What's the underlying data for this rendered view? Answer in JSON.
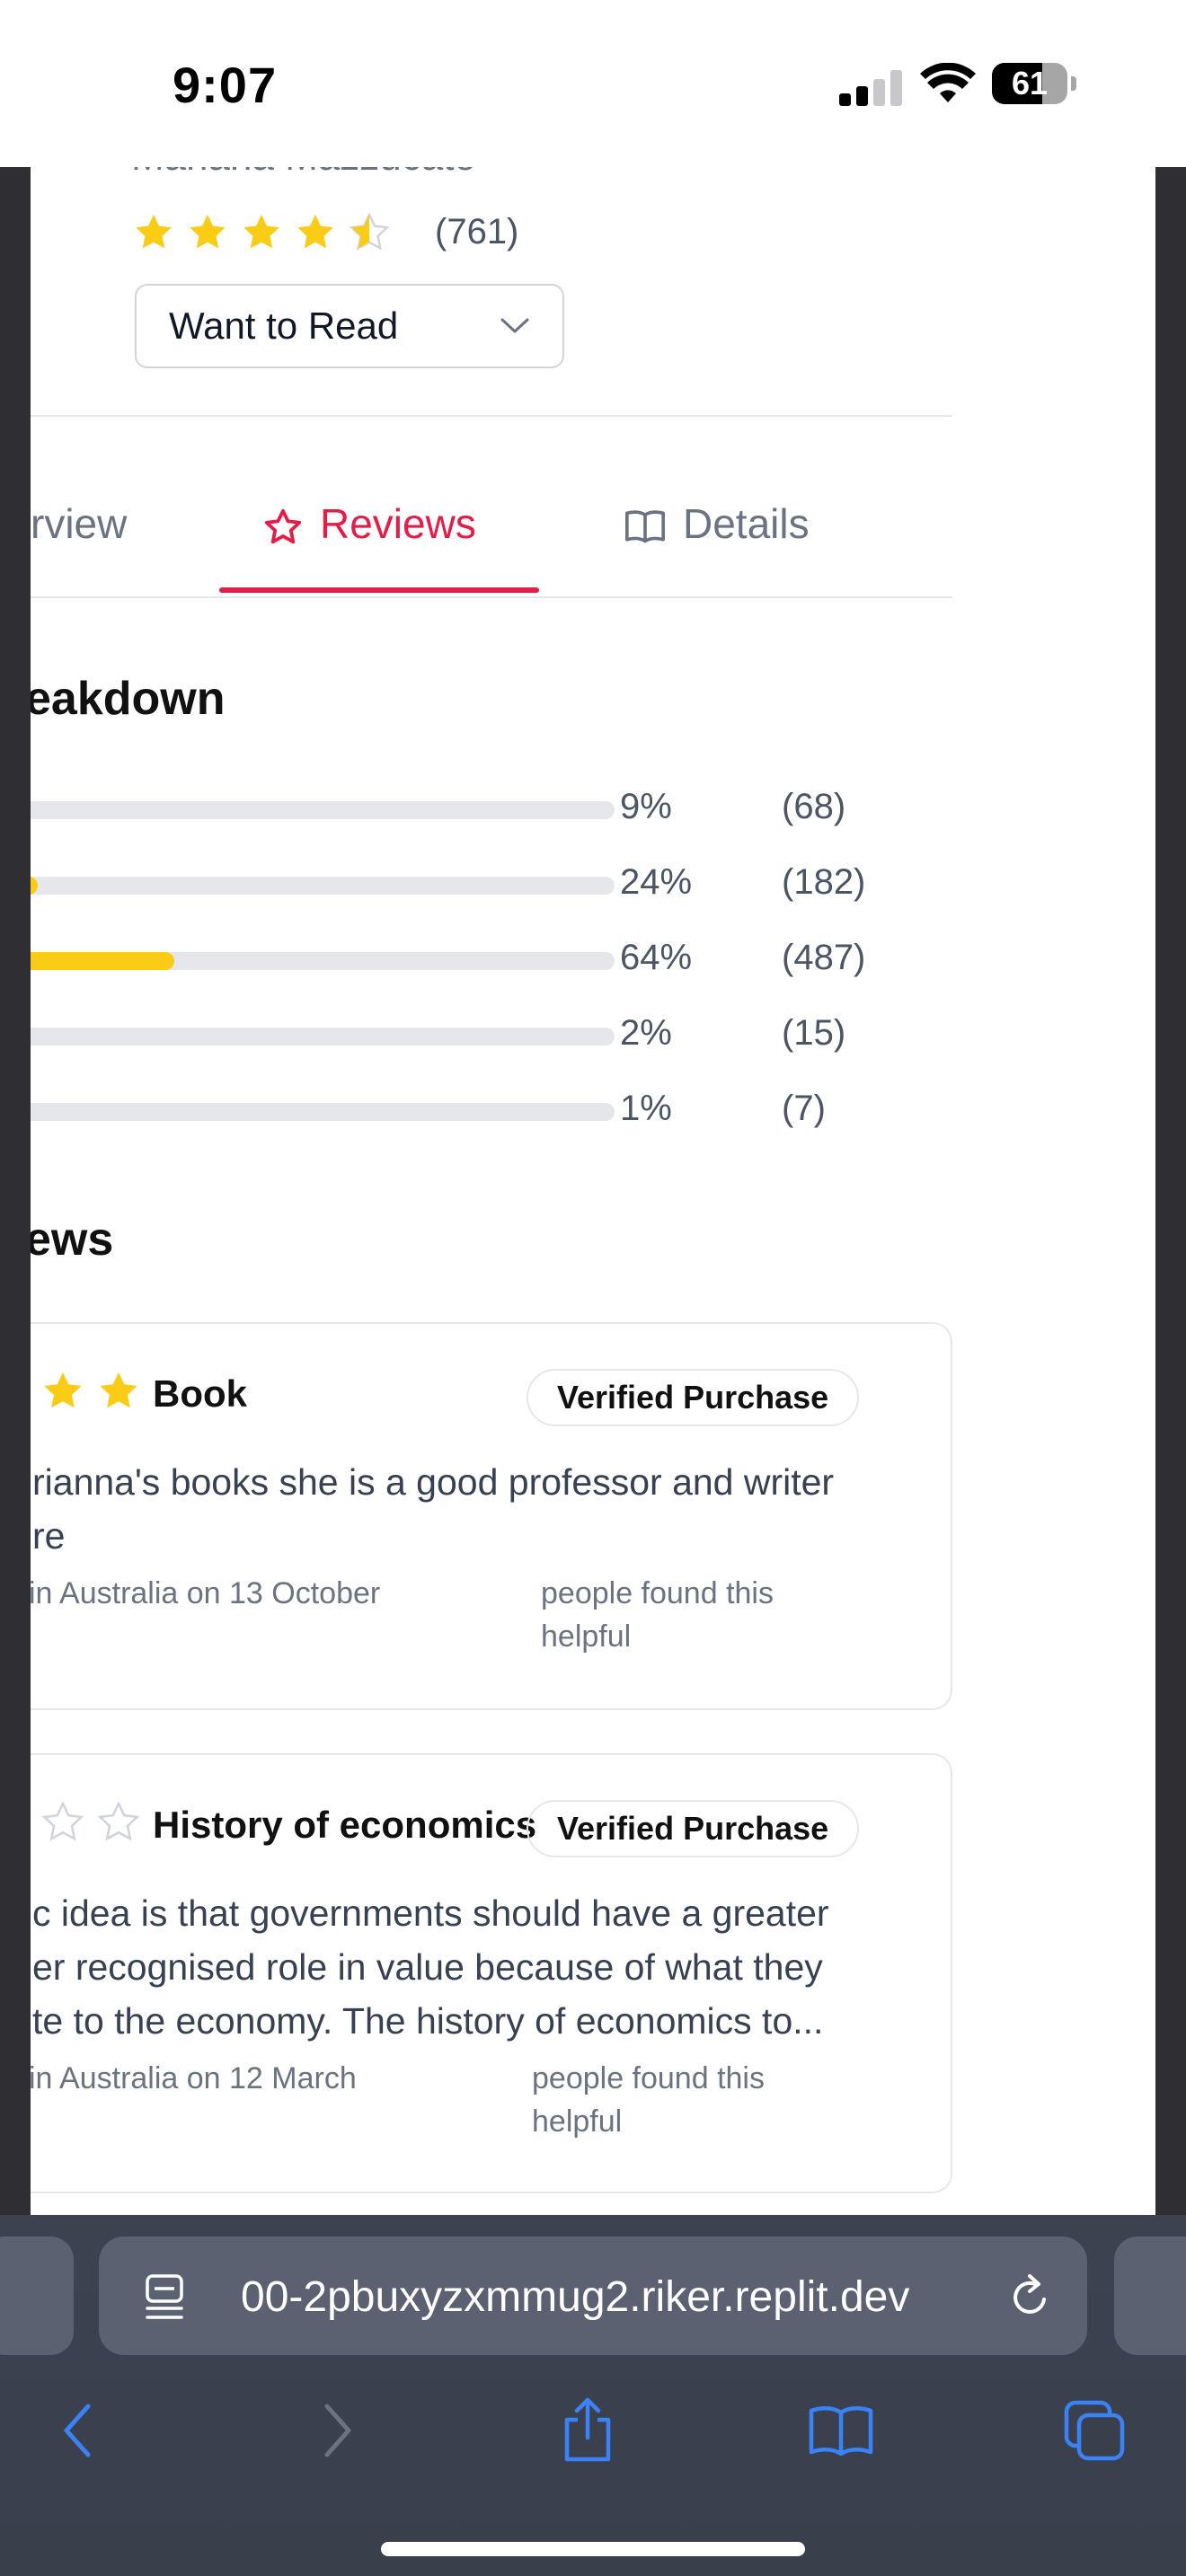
{
  "status_bar": {
    "time": "9:07",
    "battery": "61"
  },
  "book": {
    "author_partial": "Mariana Mazzucato",
    "rating_stars": 4.5,
    "rating_count": "(761)",
    "shelf_button": "Want to Read"
  },
  "tabs": [
    {
      "label": "rview",
      "icon": "eye-icon",
      "active": false
    },
    {
      "label": "Reviews",
      "icon": "star-icon",
      "active": true
    },
    {
      "label": "Details",
      "icon": "book-open-icon",
      "active": false
    }
  ],
  "breakdown": {
    "title": "eakdown",
    "rows": [
      {
        "fraction": 0.0,
        "pct": "9%",
        "count": "(68)"
      },
      {
        "fraction": 0.07,
        "pct": "24%",
        "count": "(182)"
      },
      {
        "fraction": 0.29,
        "pct": "64%",
        "count": "(487)"
      },
      {
        "fraction": 0.0,
        "pct": "2%",
        "count": "(15)"
      },
      {
        "fraction": 0.0,
        "pct": "1%",
        "count": "(7)"
      }
    ]
  },
  "reviews_section": {
    "title": "ews",
    "reviews": [
      {
        "title": "Book",
        "badge": "Verified Purchase",
        "body_line1": "rianna's books she is a good professor and writer",
        "body_line2": "re",
        "body_line3": "",
        "meta_left": "in Australia on 13 October",
        "meta_right_line1": "people found this",
        "meta_right_line2": "helpful"
      },
      {
        "title": "History of economics",
        "badge": "Verified Purchase",
        "body_line1": "c idea is that governments should have a greater",
        "body_line2": "er recognised role in value because of what they",
        "body_line3": "te to the economy. The history of economics to...",
        "meta_left": "in Australia on 12 March",
        "meta_right_line1": "people found this",
        "meta_right_line2": "helpful"
      }
    ]
  },
  "browser": {
    "url": "00-2pbuxyzxmmug2.riker.replit.dev",
    "accent": "#3b82f6"
  },
  "colors": {
    "accent": "#e11d48",
    "star": "#facc15",
    "bar_track": "#e5e7eb"
  }
}
